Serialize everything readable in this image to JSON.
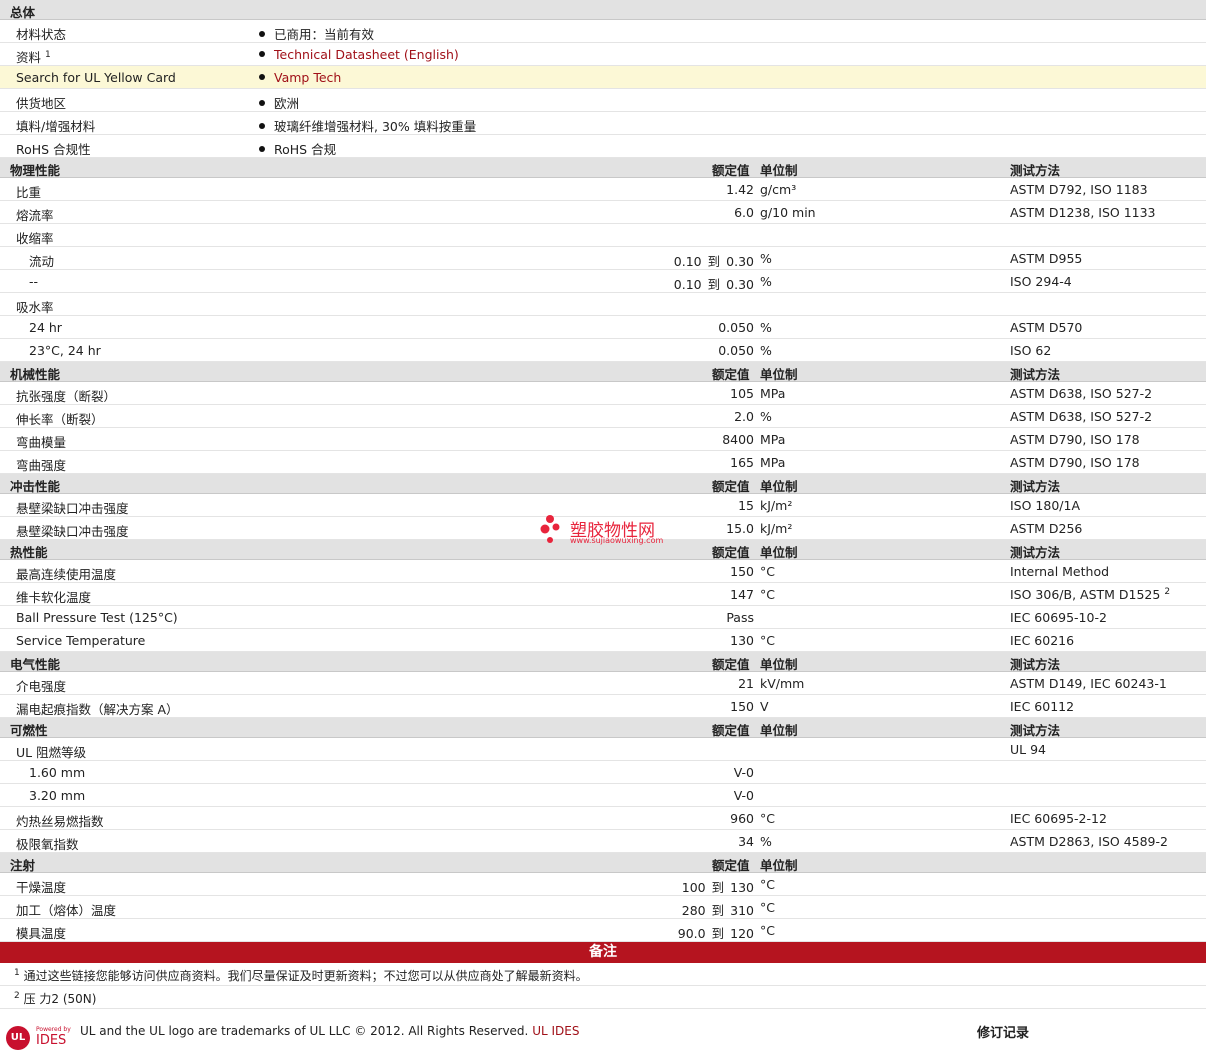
{
  "general": {
    "title": "总体",
    "rows": [
      {
        "label": "材料状态",
        "value": "已商用：当前有效",
        "link": false
      },
      {
        "label": "资料",
        "sup": "1",
        "value": "Technical Datasheet (English)",
        "link": true
      },
      {
        "label": "Search for UL Yellow Card",
        "value": "Vamp Tech",
        "link": true,
        "highlight": true
      },
      {
        "label": "供货地区",
        "value": "欧洲",
        "link": false
      },
      {
        "label": "填料/增强材料",
        "value": "玻璃纤维增强材料, 30% 填料按重量",
        "link": false
      },
      {
        "label": "RoHS 合规性",
        "value": "RoHS 合规",
        "link": false
      }
    ]
  },
  "headers": {
    "nominal": "额定值",
    "unit": "单位制",
    "method": "测试方法"
  },
  "range_word": "到",
  "physical": {
    "title": "物理性能",
    "rows": [
      {
        "label": "比重",
        "value": "1.42",
        "unit": "g/cm³",
        "method": "ASTM D792, ISO 1183"
      },
      {
        "label": "熔流率",
        "value": "6.0",
        "unit": "g/10 min",
        "method": "ASTM D1238, ISO 1133"
      },
      {
        "label": "收缩率"
      },
      {
        "label": "流动",
        "sub": true,
        "min": "0.10",
        "max": "0.30",
        "unit": "%",
        "method": "ASTM D955"
      },
      {
        "label": "--",
        "sub": true,
        "min": "0.10",
        "max": "0.30",
        "unit": "%",
        "method": "ISO 294-4"
      },
      {
        "label": "吸水率"
      },
      {
        "label": "24 hr",
        "sub": true,
        "value": "0.050",
        "unit": "%",
        "method": "ASTM D570"
      },
      {
        "label": "23°C, 24 hr",
        "sub": true,
        "value": "0.050",
        "unit": "%",
        "method": "ISO 62"
      }
    ]
  },
  "mechanical": {
    "title": "机械性能",
    "rows": [
      {
        "label": "抗张强度（断裂）",
        "value": "105",
        "unit": "MPa",
        "method": "ASTM D638, ISO 527-2"
      },
      {
        "label": "伸长率（断裂）",
        "value": "2.0",
        "unit": "%",
        "method": "ASTM D638, ISO 527-2"
      },
      {
        "label": "弯曲模量",
        "value": "8400",
        "unit": "MPa",
        "method": "ASTM D790, ISO 178"
      },
      {
        "label": "弯曲强度",
        "value": "165",
        "unit": "MPa",
        "method": "ASTM D790, ISO 178"
      }
    ]
  },
  "impact": {
    "title": "冲击性能",
    "rows": [
      {
        "label": "悬壁梁缺口冲击强度",
        "value": "15",
        "unit": "kJ/m²",
        "method": "ISO 180/1A"
      },
      {
        "label": "悬壁梁缺口冲击强度",
        "value": "15.0",
        "unit": "kJ/m²",
        "method": "ASTM D256"
      }
    ]
  },
  "thermal": {
    "title": "热性能",
    "rows": [
      {
        "label": "最高连续使用温度",
        "value": "150",
        "unit": "°C",
        "method": "Internal Method"
      },
      {
        "label": "维卡软化温度",
        "value": "147",
        "unit": "°C",
        "method": "ISO 306/B, ASTM D1525",
        "method_sup": "2"
      },
      {
        "label": "Ball Pressure Test (125°C)",
        "value": "Pass",
        "value_center": true,
        "method": "IEC 60695-10-2"
      },
      {
        "label": "Service Temperature",
        "value": "130",
        "unit": "°C",
        "method": "IEC 60216"
      }
    ]
  },
  "electrical": {
    "title": "电气性能",
    "rows": [
      {
        "label": "介电强度",
        "value": "21",
        "unit": "kV/mm",
        "method": "ASTM D149, IEC 60243-1"
      },
      {
        "label": "漏电起痕指数（解决方案 A）",
        "value": "150",
        "unit": "V",
        "method": "IEC 60112"
      }
    ]
  },
  "flammability": {
    "title": "可燃性",
    "rows": [
      {
        "label": "UL 阻燃等级",
        "method": "UL 94"
      },
      {
        "label": "1.60 mm",
        "sub": true,
        "value": "V-0",
        "value_center": true
      },
      {
        "label": "3.20 mm",
        "sub": true,
        "value": "V-0",
        "value_center": true
      },
      {
        "label": "灼热丝易燃指数",
        "value": "960",
        "unit": "°C",
        "method": "IEC 60695-2-12"
      },
      {
        "label": "极限氧指数",
        "value": "34",
        "unit": "%",
        "method": "ASTM D2863, ISO 4589-2"
      }
    ]
  },
  "injection": {
    "title": "注射",
    "rows": [
      {
        "label": "干燥温度",
        "min": "100",
        "max": "130",
        "unit": "°C"
      },
      {
        "label": "加工（熔体）温度",
        "min": "280",
        "max": "310",
        "unit": "°C"
      },
      {
        "label": "模具温度",
        "min": "90.0",
        "max": "120",
        "unit": "°C"
      }
    ]
  },
  "notes": {
    "title": "备注",
    "items": [
      {
        "num": "1",
        "text": "通过这些链接您能够访问供应商资料。我们尽量保证及时更新资料；不过您可以从供应商处了解最新资料。"
      },
      {
        "num": "2",
        "text": "压 力2 (50N)"
      }
    ]
  },
  "footer": {
    "trademark": "UL and the UL logo are trademarks of UL LLC © 2012. All Rights Reserved.",
    "ul_ides": "UL IDES",
    "revision_title": "修订记录",
    "powered_by": "Powered by",
    "ides_logo_text": "IDES"
  },
  "watermark": {
    "title": "塑胶物性网",
    "url": "www.sujiaowuxing.com"
  },
  "colors": {
    "section_bg": "#e2e2e2",
    "highlight_row": "#fcf8d6",
    "link": "#a01018",
    "notes_bar": "#b5141f"
  }
}
